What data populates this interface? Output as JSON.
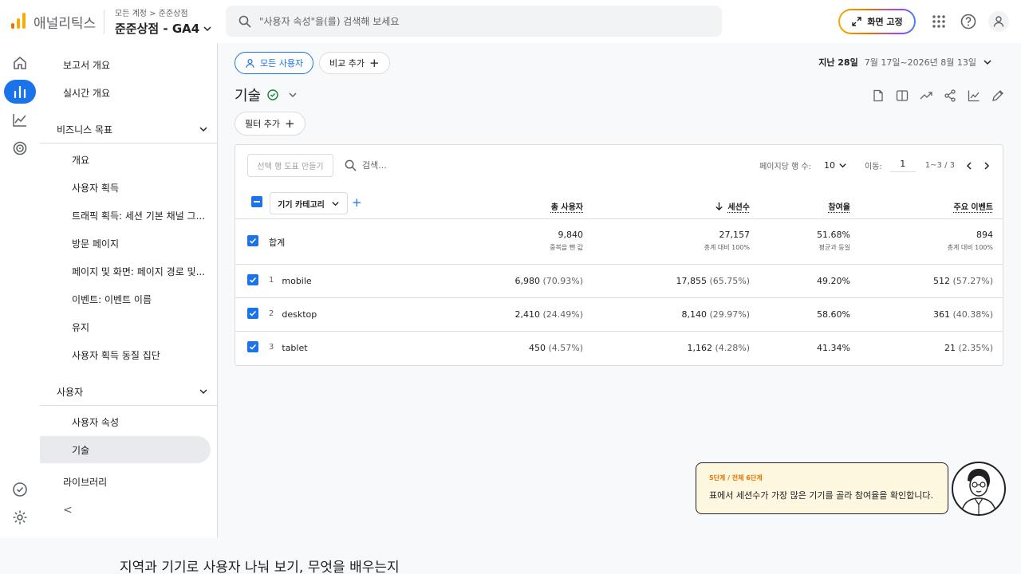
{
  "app": {
    "name": "애널리틱스"
  },
  "breadcrumb": {
    "account": "모든 계정",
    "sep": ">",
    "property": "준준상점"
  },
  "property_selector": {
    "label": "준준상점 - GA4"
  },
  "search": {
    "placeholder": "\"사용자 속성\"을(를) 검색해 보세요"
  },
  "header": {
    "fix_label": "화면 고정"
  },
  "nav": {
    "report_overview": "보고서 개요",
    "realtime": "실시간 개요",
    "business_section": "비즈니스 목표",
    "business_items": [
      "개요",
      "사용자 획득",
      "트래픽 획득: 세션 기본 채널 그...",
      "방문 페이지",
      "페이지 및 화면: 페이지 경로 및...",
      "이벤트: 이벤트 이름",
      "유지",
      "사용자 획득 동질 집단"
    ],
    "user_section": "사용자",
    "user_items": [
      "사용자 속성",
      "기술"
    ],
    "library": "라이브러리",
    "collapse": "<"
  },
  "toolbar": {
    "all_users": "모든 사용자",
    "compare": "비교 추가",
    "date_prefix": "지난 28일",
    "date_range": "7월 17일~2026년 8월 13일",
    "title": "기술",
    "filter": "필터 추가"
  },
  "table": {
    "make_chart": "선택 행 도표 만들기",
    "search_placeholder": "검색...",
    "rows_per_page_label": "페이지당 행 수:",
    "rows_per_page": "10",
    "goto_label": "이동:",
    "goto_value": "1",
    "range": "1~3 / 3",
    "dimension": "기기 카테고리",
    "columns": [
      "총 사용자",
      "세션수",
      "참여율",
      "주요 이벤트"
    ],
    "total": {
      "label": "합계",
      "users": "9,840",
      "users_sub": "중복을 뺀 값",
      "sessions": "27,157",
      "sessions_sub": "총계 대비 100%",
      "engagement": "51.68%",
      "engagement_sub": "평균과 동일",
      "events": "894",
      "events_sub": "총계 대비 100%"
    },
    "rows": [
      {
        "idx": "1",
        "name": "mobile",
        "users": "6,980",
        "users_pct": "(70.93%)",
        "sessions": "17,855",
        "sessions_pct": "(65.75%)",
        "engagement": "49.20%",
        "events": "512",
        "events_pct": "(57.27%)"
      },
      {
        "idx": "2",
        "name": "desktop",
        "users": "2,410",
        "users_pct": "(24.49%)",
        "sessions": "8,140",
        "sessions_pct": "(29.97%)",
        "engagement": "58.60%",
        "events": "361",
        "events_pct": "(40.38%)"
      },
      {
        "idx": "3",
        "name": "tablet",
        "users": "450",
        "users_pct": "(4.57%)",
        "sessions": "1,162",
        "sessions_pct": "(4.28%)",
        "engagement": "41.34%",
        "events": "21",
        "events_pct": "(2.35%)"
      }
    ]
  },
  "tooltip": {
    "step": "5단계 / 전체 6단계",
    "message": "표에서 세션수가 가장 많은 기기를 골라 참여율을 확인합니다."
  },
  "footer": {
    "caption": "지역과 기기로 사용자 나눠 보기, 무엇을 배우는지"
  },
  "colors": {
    "accent": "#1a73e8",
    "active_nav": "#e8f0fe",
    "logo_orange": "#f9ab00",
    "logo_dark": "#e37400"
  }
}
